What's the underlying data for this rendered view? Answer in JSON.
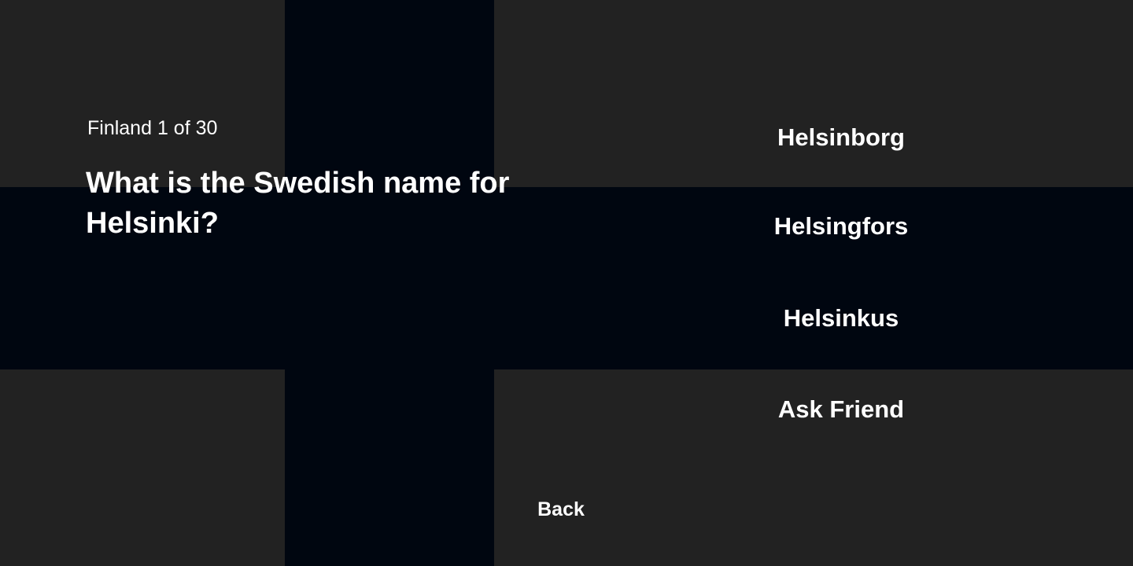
{
  "quiz": {
    "progress": "Finland 1 of 30",
    "question": "What is the Swedish name for Helsinki?",
    "answers": [
      "Helsinborg",
      "Helsingfors",
      "Helsinkus"
    ],
    "ask_friend_label": "Ask Friend",
    "back_label": "Back"
  },
  "colors": {
    "background": "#222222",
    "cross": "#000610",
    "text": "#ffffff"
  }
}
